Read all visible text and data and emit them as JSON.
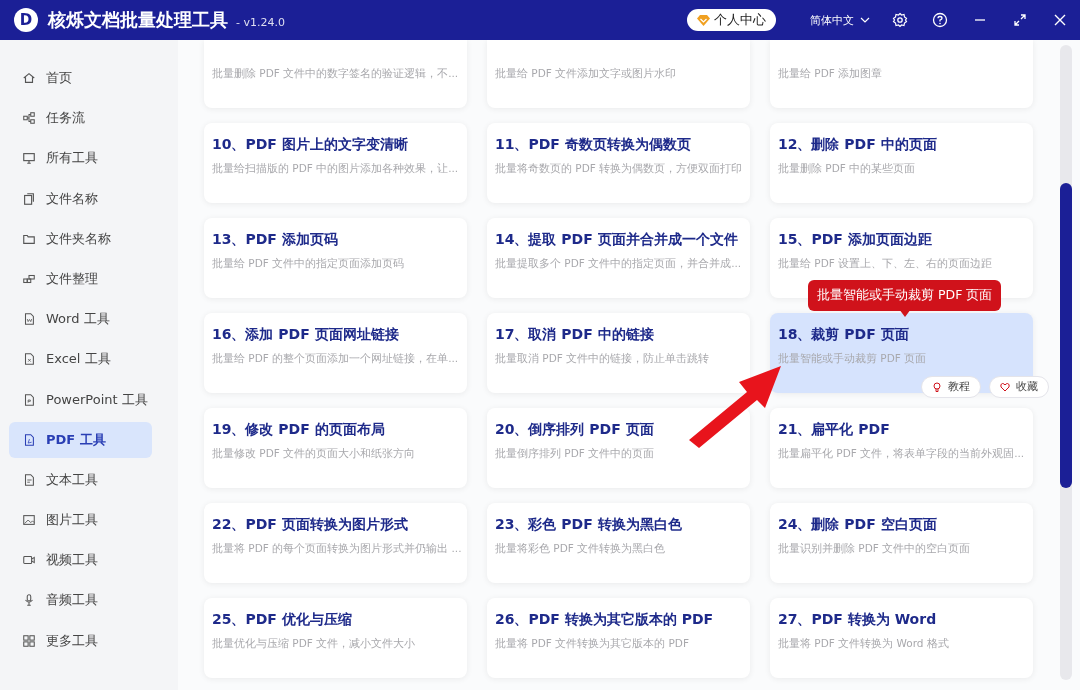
{
  "header": {
    "logo_letter": "D",
    "title": "核烁文档批量处理工具",
    "version": "- v1.24.0",
    "account_button": "个人中心",
    "language": "简体中文"
  },
  "tooltip": "批量智能或手动裁剪 PDF 页面",
  "hover_actions": [
    "教程",
    "收藏"
  ],
  "sidebar": {
    "items": [
      {
        "label": "首页",
        "selected": false
      },
      {
        "label": "任务流",
        "selected": false
      },
      {
        "label": "所有工具",
        "selected": false
      },
      {
        "label": "文件名称",
        "selected": false
      },
      {
        "label": "文件夹名称",
        "selected": false
      },
      {
        "label": "文件整理",
        "selected": false
      },
      {
        "label": "Word 工具",
        "selected": false
      },
      {
        "label": "Excel 工具",
        "selected": false
      },
      {
        "label": "PowerPoint 工具",
        "selected": false
      },
      {
        "label": "PDF 工具",
        "selected": true
      },
      {
        "label": "文本工具",
        "selected": false
      },
      {
        "label": "图片工具",
        "selected": false
      },
      {
        "label": "视频工具",
        "selected": false
      },
      {
        "label": "音频工具",
        "selected": false
      },
      {
        "label": "更多工具",
        "selected": false
      }
    ]
  },
  "cards": [
    {
      "kind": "cut",
      "description": "批量删除 PDF 文件中的数字签名的验证逻辑，不...",
      "selected": false
    },
    {
      "kind": "cut",
      "description": "批量给 PDF 文件添加文字或图片水印",
      "selected": false
    },
    {
      "kind": "cut",
      "description": "批量给 PDF 添加图章",
      "selected": false
    },
    {
      "kind": "full",
      "title": "10、PDF 图片上的文字变清晰",
      "description": "批量给扫描版的 PDF 中的图片添加各种效果，让...",
      "selected": false
    },
    {
      "kind": "full",
      "title": "11、PDF 奇数页转换为偶数页",
      "description": "批量将奇数页的 PDF 转换为偶数页，方便双面打印",
      "selected": false
    },
    {
      "kind": "full",
      "title": "12、删除 PDF 中的页面",
      "description": "批量删除 PDF 中的某些页面",
      "selected": false
    },
    {
      "kind": "full",
      "title": "13、PDF 添加页码",
      "description": "批量给 PDF 文件中的指定页面添加页码",
      "selected": false
    },
    {
      "kind": "full",
      "title": "14、提取 PDF 页面并合并成一个文件",
      "description": "批量提取多个 PDF 文件中的指定页面，并合并成...",
      "selected": false
    },
    {
      "kind": "full",
      "title": "15、PDF 添加页面边距",
      "description": "批量给 PDF 设置上、下、左、右的页面边距",
      "selected": false
    },
    {
      "kind": "full",
      "title": "16、添加 PDF 页面网址链接",
      "description": "批量给 PDF 的整个页面添加一个网址链接，在单...",
      "selected": false
    },
    {
      "kind": "full",
      "title": "17、取消 PDF 中的链接",
      "description": "批量取消 PDF 文件中的链接，防止单击跳转",
      "selected": false
    },
    {
      "kind": "full",
      "title": "18、裁剪 PDF 页面",
      "description": "批量智能或手动裁剪 PDF 页面",
      "selected": true
    },
    {
      "kind": "full",
      "title": "19、修改 PDF 的页面布局",
      "description": "批量修改 PDF 文件的页面大小和纸张方向",
      "selected": false
    },
    {
      "kind": "full",
      "title": "20、倒序排列 PDF 页面",
      "description": "批量倒序排列 PDF 文件中的页面",
      "selected": false
    },
    {
      "kind": "full",
      "title": "21、扁平化 PDF",
      "description": "批量扁平化 PDF 文件，将表单字段的当前外观固...",
      "selected": false
    },
    {
      "kind": "full",
      "title": "22、PDF 页面转换为图片形式",
      "description": "批量将 PDF 的每个页面转换为图片形式并仍输出 ...",
      "selected": false
    },
    {
      "kind": "full",
      "title": "23、彩色 PDF 转换为黑白色",
      "description": "批量将彩色 PDF 文件转换为黑白色",
      "selected": false
    },
    {
      "kind": "full",
      "title": "24、删除 PDF 空白页面",
      "description": "批量识别并删除 PDF 文件中的空白页面",
      "selected": false
    },
    {
      "kind": "full",
      "title": "25、PDF 优化与压缩",
      "description": "批量优化与压缩 PDF 文件，减小文件大小",
      "selected": false
    },
    {
      "kind": "full",
      "title": "26、PDF 转换为其它版本的 PDF",
      "description": "批量将 PDF 文件转换为其它版本的 PDF",
      "selected": false
    },
    {
      "kind": "full",
      "title": "27、PDF 转换为 Word",
      "description": "批量将 PDF 文件转换为 Word 格式",
      "selected": false
    }
  ]
}
